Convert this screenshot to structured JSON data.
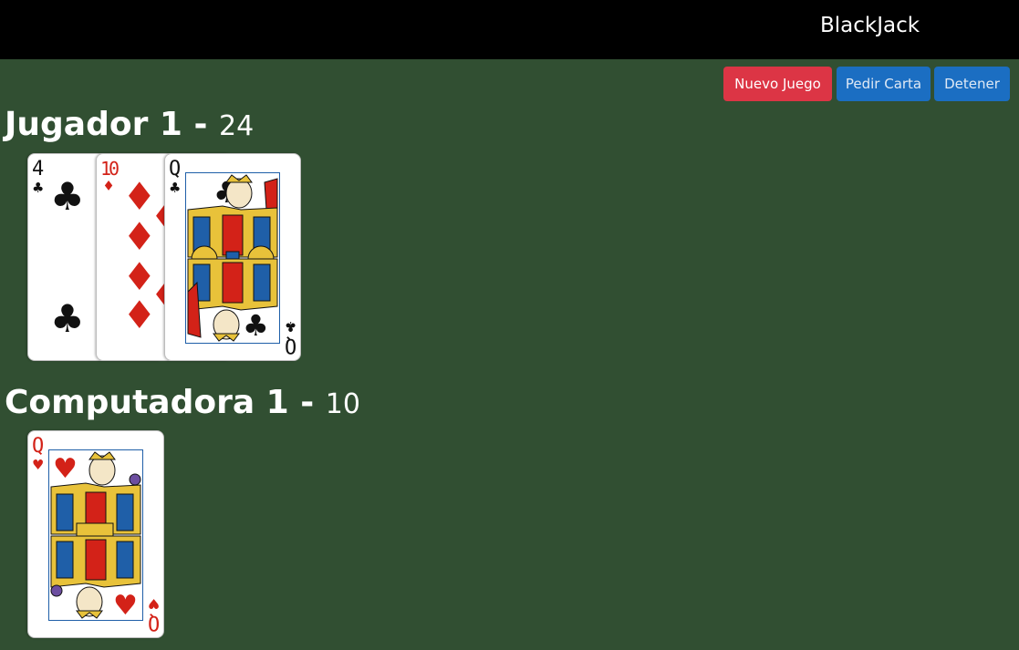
{
  "header": {
    "title": "BlackJack"
  },
  "controls": {
    "new_game_label": "Nuevo Juego",
    "hit_label": "Pedir Carta",
    "stand_label": "Detener"
  },
  "player": {
    "name": "Jugador 1",
    "separator": "-",
    "score": "24",
    "cards": [
      {
        "rank": "4",
        "suit": "♣",
        "color": "black"
      },
      {
        "rank": "10",
        "suit": "♦",
        "color": "red"
      },
      {
        "rank": "Q",
        "suit": "♣",
        "color": "black"
      }
    ]
  },
  "computer": {
    "name": "Computadora 1",
    "separator": "-",
    "score": "10",
    "cards": [
      {
        "rank": "Q",
        "suit": "♥",
        "color": "red"
      }
    ]
  },
  "colors": {
    "table": "#314f32",
    "topbar": "#000000",
    "danger": "#dc3545",
    "primary": "#1b6ec2"
  }
}
